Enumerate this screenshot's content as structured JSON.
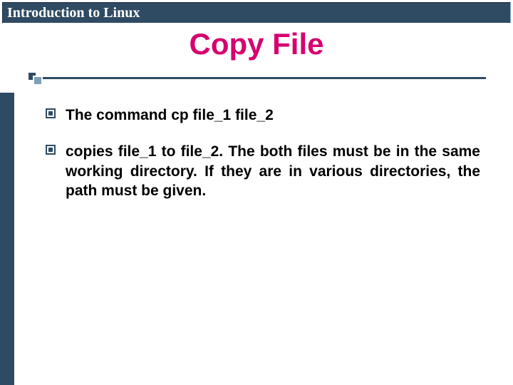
{
  "header": {
    "title": "Introduction to Linux"
  },
  "slide": {
    "title": "Copy File",
    "bullets": [
      "The command cp file_1 file_2",
      "copies file_1 to file_2. The both files must be in the same working directory. If they are in various directories, the path must be given."
    ]
  },
  "colors": {
    "accent": "#2f4a63",
    "title": "#d6006f"
  }
}
